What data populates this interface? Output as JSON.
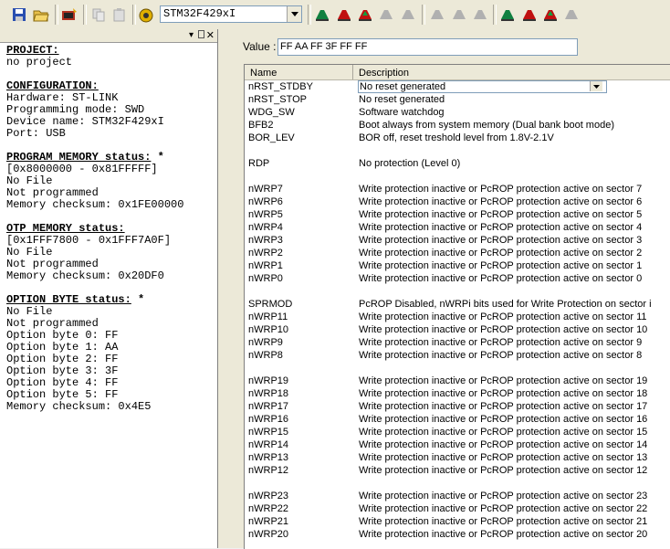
{
  "toolbar": {
    "device": "STM32F429xI",
    "icons": [
      "save-icon",
      "open-icon",
      "connect-icon",
      "copy-icon",
      "paste-icon",
      "erase-icon",
      "target-icon",
      "device-select",
      "green-arrow-1",
      "red-arrow-1",
      "red-arrow-2",
      "gray-arrow-1",
      "gray-arrow-2",
      "gray-arrow-3",
      "gray-arrow-4",
      "gray-arrow-5",
      "gray-arrow-6",
      "green-arrow-2",
      "red-arrow-3",
      "red-arrow-4",
      "gray-arrow-7"
    ]
  },
  "left": {
    "project_header": "PROJECT:",
    "project_value": "no project",
    "config_header": "CONFIGURATION:",
    "hardware": "Hardware: ST-LINK",
    "programming_mode": "Programming mode: SWD",
    "device_name": "Device name: STM32F429xI",
    "port": "Port: USB",
    "program_header": "PROGRAM MEMORY status:",
    "program_star": " *",
    "program_range": "[0x8000000 - 0x81FFFFF]",
    "program_file": "No File",
    "program_status": "Not programmed",
    "program_checksum": "Memory checksum: 0x1FE00000",
    "otp_header": "OTP MEMORY status:",
    "otp_range": "[0x1FFF7800 - 0x1FFF7A0F]",
    "otp_file": "No File",
    "otp_status": "Not programmed",
    "otp_checksum": "Memory checksum: 0x20DF0",
    "ob_header": "OPTION BYTE status:",
    "ob_star": " *",
    "ob_file": "No File",
    "ob_status": "Not programmed",
    "ob0": "Option byte 0: FF",
    "ob1": "Option byte 1: AA",
    "ob2": "Option byte 2: FF",
    "ob3": "Option byte 3: 3F",
    "ob4": "Option byte 4: FF",
    "ob5": "Option byte 5: FF",
    "ob_checksum": "Memory checksum: 0x4E5"
  },
  "right": {
    "value_label": "Value :",
    "value": "FF AA FF 3F FF FF",
    "col_name": "Name",
    "col_desc": "Description",
    "rows": [
      {
        "name": "nRST_STDBY",
        "desc": "No reset generated"
      },
      {
        "name": "nRST_STOP",
        "desc": "No reset generated"
      },
      {
        "name": "WDG_SW",
        "desc": "Software watchdog"
      },
      {
        "name": "BFB2",
        "desc": "Boot always from system memory (Dual bank boot mode)"
      },
      {
        "name": "BOR_LEV",
        "desc": "BOR off, reset treshold level from 1.8V-2.1V"
      },
      {
        "name": "",
        "desc": ""
      },
      {
        "name": "RDP",
        "desc": "No protection (Level 0)"
      },
      {
        "name": "",
        "desc": ""
      },
      {
        "name": "nWRP7",
        "desc": "Write protection inactive or PcROP protection active on sector 7"
      },
      {
        "name": "nWRP6",
        "desc": "Write protection inactive or PcROP protection active on sector 6"
      },
      {
        "name": "nWRP5",
        "desc": "Write protection inactive or PcROP protection active on sector 5"
      },
      {
        "name": "nWRP4",
        "desc": "Write protection inactive or PcROP protection active on sector 4"
      },
      {
        "name": "nWRP3",
        "desc": "Write protection inactive or PcROP protection active on sector 3"
      },
      {
        "name": "nWRP2",
        "desc": "Write protection inactive or PcROP protection active on sector 2"
      },
      {
        "name": "nWRP1",
        "desc": "Write protection inactive or PcROP protection active on sector 1"
      },
      {
        "name": "nWRP0",
        "desc": "Write protection inactive or PcROP protection active on sector 0"
      },
      {
        "name": "",
        "desc": ""
      },
      {
        "name": "SPRMOD",
        "desc": "PcROP Disabled, nWRPi bits used for Write Protection on sector i"
      },
      {
        "name": "nWRP11",
        "desc": "Write protection inactive or PcROP protection active on sector 11"
      },
      {
        "name": "nWRP10",
        "desc": "Write protection inactive or PcROP protection active on sector 10"
      },
      {
        "name": "nWRP9",
        "desc": "Write protection inactive or PcROP protection active on sector 9"
      },
      {
        "name": "nWRP8",
        "desc": "Write protection inactive or PcROP protection active on sector 8"
      },
      {
        "name": "",
        "desc": ""
      },
      {
        "name": "nWRP19",
        "desc": "Write protection inactive or PcROP protection active on sector 19"
      },
      {
        "name": "nWRP18",
        "desc": "Write protection inactive or PcROP protection active on sector 18"
      },
      {
        "name": "nWRP17",
        "desc": "Write protection inactive or PcROP protection active on sector 17"
      },
      {
        "name": "nWRP16",
        "desc": "Write protection inactive or PcROP protection active on sector 16"
      },
      {
        "name": "nWRP15",
        "desc": "Write protection inactive or PcROP protection active on sector 15"
      },
      {
        "name": "nWRP14",
        "desc": "Write protection inactive or PcROP protection active on sector 14"
      },
      {
        "name": "nWRP13",
        "desc": "Write protection inactive or PcROP protection active on sector 13"
      },
      {
        "name": "nWRP12",
        "desc": "Write protection inactive or PcROP protection active on sector 12"
      },
      {
        "name": "",
        "desc": ""
      },
      {
        "name": "nWRP23",
        "desc": "Write protection inactive or PcROP protection active on sector 23"
      },
      {
        "name": "nWRP22",
        "desc": "Write protection inactive or PcROP protection active on sector 22"
      },
      {
        "name": "nWRP21",
        "desc": "Write protection inactive or PcROP protection active on sector 21"
      },
      {
        "name": "nWRP20",
        "desc": "Write protection inactive or PcROP protection active on sector 20"
      }
    ]
  }
}
